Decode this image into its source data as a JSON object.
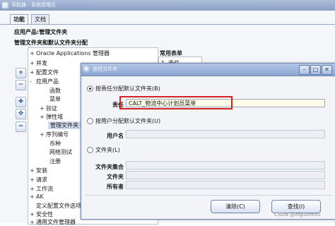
{
  "back_window": {
    "title": "导航器 - 系统管理员",
    "tabs": [
      "功能",
      "文档"
    ],
    "heading1": "应用产品:管理文件夹",
    "heading2": "管理文件夹和默认文件夹分配",
    "tree_header": "Oracle Applications 管理器",
    "tree": [
      {
        "exp": "+",
        "label": "并发"
      },
      {
        "exp": "+",
        "label": "配置文件"
      },
      {
        "exp": "-",
        "label": "应用产品"
      },
      {
        "exp": "",
        "label": "函数"
      },
      {
        "exp": "",
        "label": "菜单"
      },
      {
        "exp": "+",
        "label": "验证"
      },
      {
        "exp": "+",
        "label": "弹性域"
      },
      {
        "exp": "",
        "label": "管理文件夹"
      },
      {
        "exp": "+",
        "label": "序列编号"
      },
      {
        "exp": "",
        "label": "币种"
      },
      {
        "exp": "",
        "label": "网络测试"
      },
      {
        "exp": "",
        "label": "注册"
      },
      {
        "exp": "+",
        "label": "安装"
      },
      {
        "exp": "+",
        "label": "请求"
      },
      {
        "exp": "+",
        "label": "工作流"
      },
      {
        "exp": "+",
        "label": "AK"
      },
      {
        "exp": "",
        "label": "定义配置文件选项"
      },
      {
        "exp": "+",
        "label": "安全性"
      },
      {
        "exp": "+",
        "label": "通用文件管理器"
      }
    ],
    "list_label": "常用表单",
    "list_item": "1. 责任"
  },
  "dialog": {
    "title": "查找文件夹",
    "option_responsibility": "按责任分配默认文件夹(B)",
    "field_responsibility_label": "责任",
    "field_responsibility_value": "CALT_物流中心计划员菜单",
    "option_user": "按用户分配默认文件夹(U)",
    "field_user_label": "用户名",
    "option_folder": "文件夹(L)",
    "folder_set_label": "文件夹集合",
    "folder_label": "文件夹",
    "owner_label": "所有者",
    "clear_button": "清除(C)",
    "find_button": "查找(I)"
  },
  "watermark": "CSDN @zfguohezu"
}
